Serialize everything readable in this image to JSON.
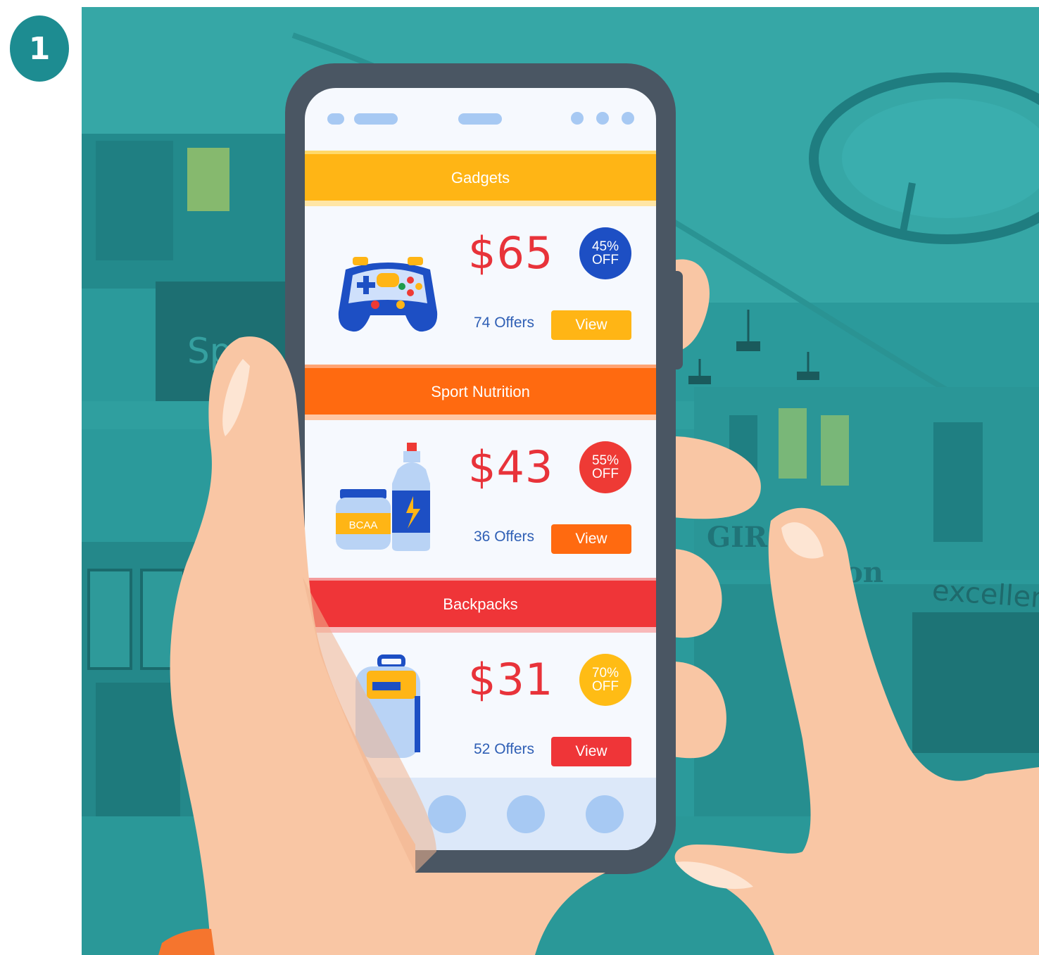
{
  "step": {
    "number": "1"
  },
  "background": {
    "signs": [
      "Sp",
      "GIR",
      "ion",
      "excellen"
    ]
  },
  "app": {
    "categories": [
      {
        "title": "Gadgets",
        "color": "#ffb515",
        "product_icon": "game-controller-icon",
        "price": "$65",
        "discount_pct": "45%",
        "discount_off": "OFF",
        "discount_color": "#1d4fc4",
        "offers": "74 Offers",
        "view_label": "View",
        "view_color": "#ffb515"
      },
      {
        "title": "Sport Nutrition",
        "color": "#ff6a10",
        "product_icon": "supplements-icon",
        "jar_label": "BCAA",
        "price": "$43",
        "discount_pct": "55%",
        "discount_off": "OFF",
        "discount_color": "#ee3a35",
        "offers": "36 Offers",
        "view_label": "View",
        "view_color": "#ff6a10"
      },
      {
        "title": "Backpacks",
        "color": "#ef3538",
        "product_icon": "backpack-icon",
        "price": "$31",
        "discount_pct": "70%",
        "discount_off": "OFF",
        "discount_color": "#ffbc15",
        "offers": "52 Offers",
        "view_label": "View",
        "view_color": "#ef3538"
      }
    ]
  }
}
